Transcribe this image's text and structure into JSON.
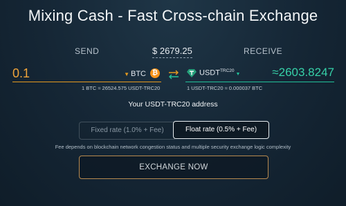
{
  "header": {
    "title": "Mixing Cash - Fast Cross-chain Exchange"
  },
  "labels": {
    "send": "SEND",
    "receive": "RECEIVE",
    "usd_value": "$ 2679.25"
  },
  "send": {
    "amount": "0.1",
    "currency": "BTC",
    "icon": "bitcoin-icon",
    "rate": "1 BTC ≈ 26524.575 USDT-TRC20",
    "accent": "#e59a1f"
  },
  "receive": {
    "currency": "USDT",
    "network": "TRC20",
    "amount": "≈2603.8247",
    "icon": "tether-icon",
    "rate": "1 USDT-TRC20 ≈ 0.000037 BTC",
    "accent": "#22c29a"
  },
  "address": {
    "label": "Your USDT-TRC20 address"
  },
  "rate_type": {
    "fixed": "Fixed rate (1.0% + Fee)",
    "float": "Float rate (0.5% + Fee)",
    "selected": "float"
  },
  "fee_note": "Fee depends on blockchain network congestion status and multiple security exchange logic complexity",
  "exchange_button": {
    "label": "EXCHANGE NOW"
  }
}
